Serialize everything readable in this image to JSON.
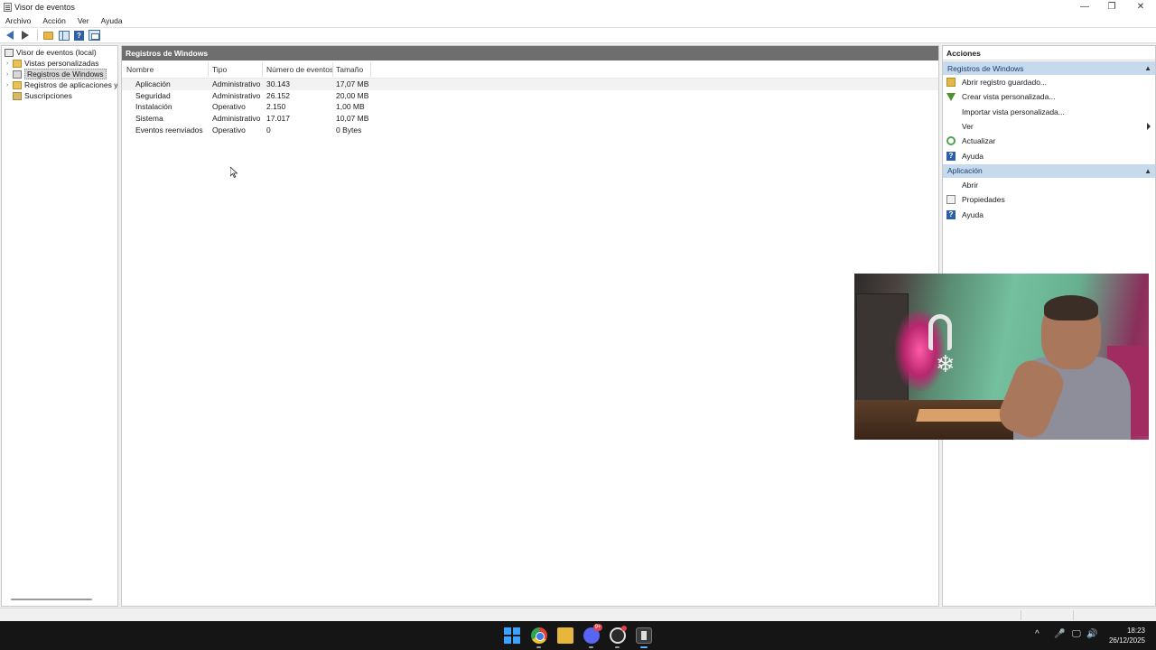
{
  "window": {
    "title": "Visor de eventos",
    "controls": {
      "minimize": "—",
      "maximize": "❐",
      "close": "✕"
    }
  },
  "menu": [
    "Archivo",
    "Acción",
    "Ver",
    "Ayuda"
  ],
  "toolbar": {
    "icons": [
      "back-arrow-icon",
      "forward-arrow-icon",
      "folder-icon",
      "show-hide-tree-icon",
      "help-icon",
      "show-hide-action-pane-icon"
    ]
  },
  "tree": {
    "root": "Visor de eventos (local)",
    "items": [
      {
        "label": "Vistas personalizadas",
        "expandable": true
      },
      {
        "label": "Registros de Windows",
        "expandable": true,
        "selected": true
      },
      {
        "label": "Registros de aplicaciones y s",
        "expandable": true
      },
      {
        "label": "Suscripciones",
        "expandable": false
      }
    ]
  },
  "center": {
    "title": "Registros de Windows",
    "columns": [
      "Nombre",
      "Tipo",
      "Número de eventos",
      "Tamaño"
    ],
    "rows": [
      [
        "Aplicación",
        "Administrativo",
        "30.143",
        "17,07 MB"
      ],
      [
        "Seguridad",
        "Administrativo",
        "26.152",
        "20,00 MB"
      ],
      [
        "Instalación",
        "Operativo",
        "2.150",
        "1,00 MB"
      ],
      [
        "Sistema",
        "Administrativo",
        "17.017",
        "10,07 MB"
      ],
      [
        "Eventos reenviados",
        "Operativo",
        "0",
        "0 Bytes"
      ]
    ]
  },
  "actions": {
    "title": "Acciones",
    "sections": [
      {
        "header": "Registros de Windows",
        "items": [
          {
            "label": "Abrir registro guardado...",
            "icon": "open-log-icon"
          },
          {
            "label": "Crear vista personalizada...",
            "icon": "filter-icon"
          },
          {
            "label": "Importar vista personalizada...",
            "icon": ""
          },
          {
            "label": "Ver",
            "icon": "",
            "submenu": true
          },
          {
            "label": "Actualizar",
            "icon": "refresh-icon"
          },
          {
            "label": "Ayuda",
            "icon": "help-icon",
            "submenu": true
          }
        ]
      },
      {
        "header": "Aplicación",
        "items": [
          {
            "label": "Abrir",
            "icon": ""
          },
          {
            "label": "Propiedades",
            "icon": "properties-icon"
          },
          {
            "label": "Ayuda",
            "icon": "help-icon",
            "submenu": true
          }
        ]
      }
    ]
  },
  "taskbar": {
    "apps": [
      "windows-start-icon",
      "chrome-icon",
      "file-explorer-icon",
      "discord-icon",
      "obs-icon",
      "event-viewer-icon"
    ],
    "discord_badge": "9+",
    "tray": {
      "chevron": "^",
      "mic": "🎤",
      "network": "🖵",
      "volume": "🔊"
    },
    "time": "18:23",
    "date": "26/12/2025"
  },
  "colors": {
    "header_bar": "#6e6e6e",
    "action_section": "#c7d9ec",
    "taskbar": "#151515",
    "selection": "#d9d9d9"
  }
}
